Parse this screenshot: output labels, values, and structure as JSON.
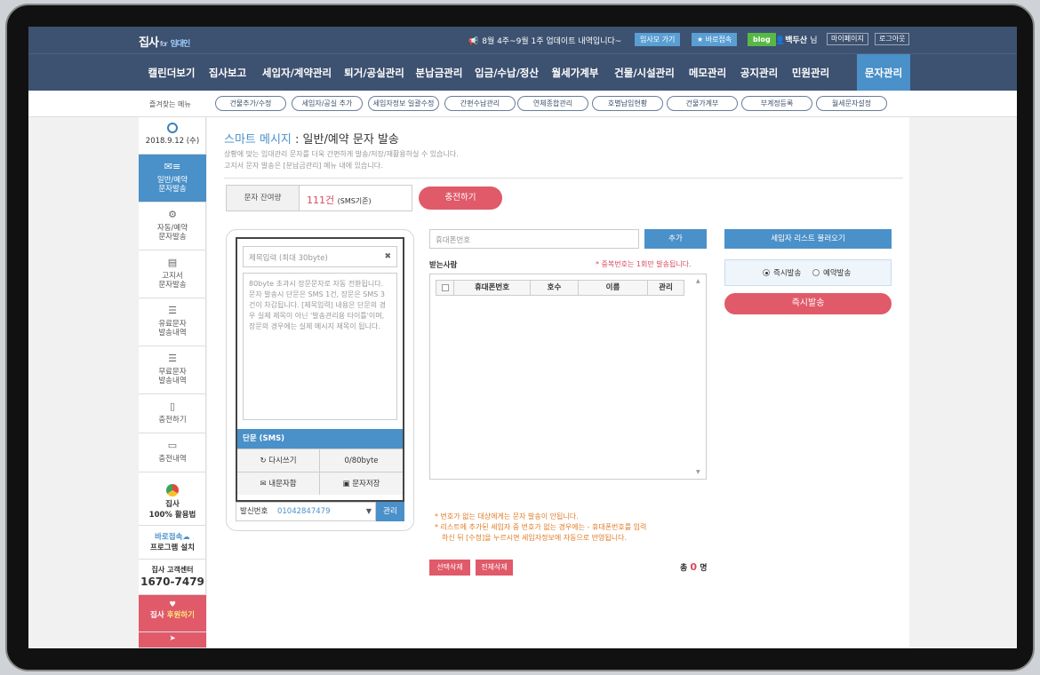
{
  "topbar": {
    "logo": "집사",
    "logo_for": "for",
    "logo_sub": "임대인",
    "notice": "8월 4주~9월 1주 업데이트 내역입니다~",
    "btn_mo": "임사모 가기",
    "btn_fast": "바로접속",
    "btn_blog": "blog",
    "user_name": "백두산",
    "user_suffix": "님",
    "link_mypage": "마이페이지",
    "link_logout": "로그아웃"
  },
  "nav": [
    "캘린더보기",
    "집사보고",
    "세입자/계약관리",
    "퇴거/공실관리",
    "분납금관리",
    "입금/수납/정산",
    "월세가계부",
    "건물/시설관리",
    "메모관리",
    "공지관리",
    "민원관리",
    "문자관리"
  ],
  "quick": {
    "label": "즐겨찾는 메뉴",
    "items": [
      "건물추가/수정",
      "세입자/공실 추가",
      "세입자정보 일괄수정",
      "간편수납관리",
      "연체종합관리",
      "호별납입현황",
      "건물가계부",
      "부계정등록",
      "월세문자설정"
    ]
  },
  "sidebar": {
    "date": "2018.9.12 (수)",
    "items": [
      {
        "line1": "일반/예약",
        "line2": "문자발송"
      },
      {
        "line1": "자동/예약",
        "line2": "문자발송"
      },
      {
        "line1": "고지서",
        "line2": "문자발송"
      },
      {
        "line1": "유료문자",
        "line2": "발송내역"
      },
      {
        "line1": "무료문자",
        "line2": "발송내역"
      },
      {
        "line1": "충전하기",
        "line2": ""
      },
      {
        "line1": "충전내역",
        "line2": ""
      }
    ],
    "promo_app_1": "집사",
    "promo_app_2": "100% 활용법",
    "promo_fast_1": "바로접속",
    "promo_fast_2": "프로그램 설치",
    "cs_label": "집사 고객센터",
    "cs_phone": "1670-7479",
    "donate_1": "집사",
    "donate_2": "후원하기"
  },
  "content": {
    "title_hl": "스마트 메시지",
    "title_rest": " : 일반/예약 문자 발송",
    "desc1": "상황에 맞는 임대관리 문자를 더욱 간편하게 발송/저장/재활용하실 수 있습니다.",
    "desc2": "고지서 문자 발송은 [분납금관리] 메뉴 내에 있습니다.",
    "remain_label": "문자 잔여량",
    "remain_count": "111건",
    "remain_unit": "(SMS기준)",
    "charge_btn": "충전하기"
  },
  "composer": {
    "subject_placeholder": "제목입력 (최대 30byte)",
    "body_text": "80byte 초과시 장문문자로 자동 전환됩니다. 문자 발송시 단문은 SMS 1건, 장문은 SMS 3건이 차감됩니다. [제목입력] 내용은 단문의 경우 실제 제목이 아닌 '발송관리용 타이틀'이며, 장문의 경우에는 실제 메시지 제목이 됩니다.",
    "type": "단문 (SMS)",
    "rewrite": "다시쓰기",
    "bytes": "0/80byte",
    "my_messages": "내문자함",
    "save": "문자저장",
    "sender_label": "발신번호",
    "sender_number": "01042847479",
    "sender_manage": "관리"
  },
  "recipients": {
    "phone_placeholder": "휴대폰번호",
    "add_btn": "추가",
    "label": "받는사람",
    "dup_note": "* 중복번호는 1회만 발송됩니다.",
    "headers": [
      "휴대폰번호",
      "호수",
      "이름",
      "관리"
    ],
    "warn1": "* 번호가 없는 대상에게는 문자 발송이 안됩니다.",
    "warn2": "* 리스트에 추가된 세입자 중 번호가 없는 경우에는 - 휴대폰번호를 입력",
    "warn3": "하신 뒤 [수정]을 누르시면 세입자정보에 자동으로 반영됩니다.",
    "del_selected": "선택삭제",
    "del_all": "전체삭제",
    "total_prefix": "총",
    "total_count": "0",
    "total_suffix": "명"
  },
  "right": {
    "load_btn": "세입자 리스트 불러오기",
    "mode_now": "즉시발송",
    "mode_reserve": "예약발송",
    "send_btn": "즉시발송"
  }
}
